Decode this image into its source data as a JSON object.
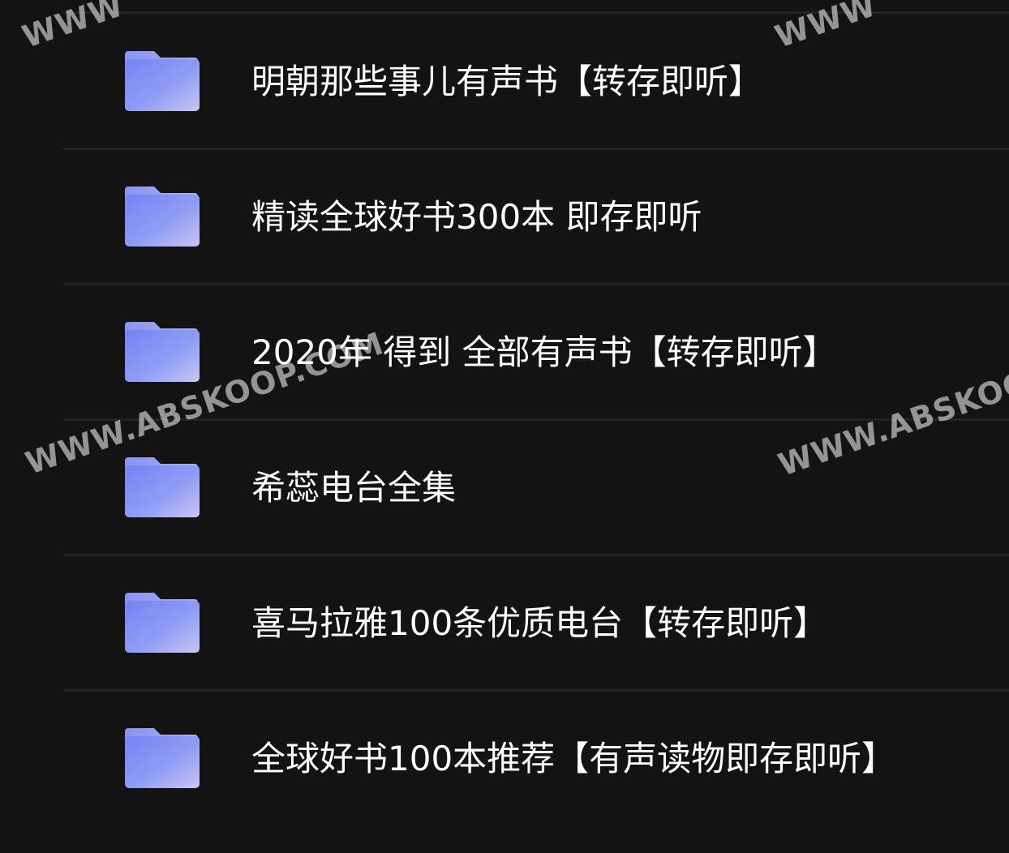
{
  "folders": [
    {
      "name": "明朝那些事儿有声书【转存即听】",
      "icon": "folder-icon"
    },
    {
      "name": "精读全球好书300本 即存即听",
      "icon": "folder-icon"
    },
    {
      "name": "2020年 得到 全部有声书【转存即听】",
      "icon": "folder-icon"
    },
    {
      "name": "希蕊电台全集",
      "icon": "folder-icon"
    },
    {
      "name": "喜马拉雅100条优质电台【转存即听】",
      "icon": "folder-icon"
    },
    {
      "name": "全球好书100本推荐【有声读物即存即听】",
      "icon": "folder-icon"
    }
  ],
  "watermark": {
    "text_left": "WWW.ABSKOOP.COM",
    "text_right": "WWW.ABSKOOP.COM",
    "text_top_left": "WWW",
    "text_top_right": "WWW"
  },
  "colors": {
    "background": "#131314",
    "divider": "#232325",
    "folder_light": "#c9c9f5",
    "folder_dark": "#7a86f4"
  }
}
